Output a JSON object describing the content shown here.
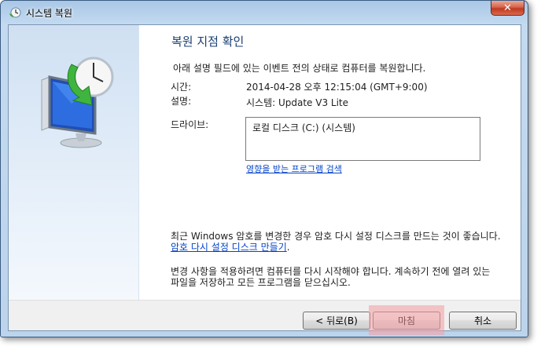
{
  "window": {
    "title": "시스템 복원",
    "close_label": "✕"
  },
  "content": {
    "heading": "복원 지점 확인",
    "description": "아래 설명 필드에 있는 이벤트 전의 상태로 컴퓨터를 복원합니다.",
    "time_label": "시간:",
    "time_value": "2014-04-28 오후 12:15:04 (GMT+9:00)",
    "desc_label": "설명:",
    "desc_value": "시스템: Update V3 Lite",
    "drives_label": "드라이브:",
    "drives": [
      "로컬 디스크 (C:) (시스템)"
    ],
    "scan_link": "영향을 받는 프로그램 검색",
    "password_note": "최근 Windows 암호를 변경한 경우 암호 다시 설정 디스크를 만드는 것이 좋습니다.",
    "password_link": "암호 다시 설정 디스크 만들기",
    "password_end": ".",
    "restart_note": "변경 사항을 적용하려면 컴퓨터를 다시 시작해야 합니다. 계속하기 전에 열려 있는 파일을 저장하고 모든 프로그램을 닫으십시오."
  },
  "buttons": {
    "back": "< 뒤로(B)",
    "finish": "마침",
    "cancel": "취소"
  },
  "colors": {
    "heading": "#1a3e72",
    "link": "#0645c8",
    "highlight": "#f69ca0"
  }
}
